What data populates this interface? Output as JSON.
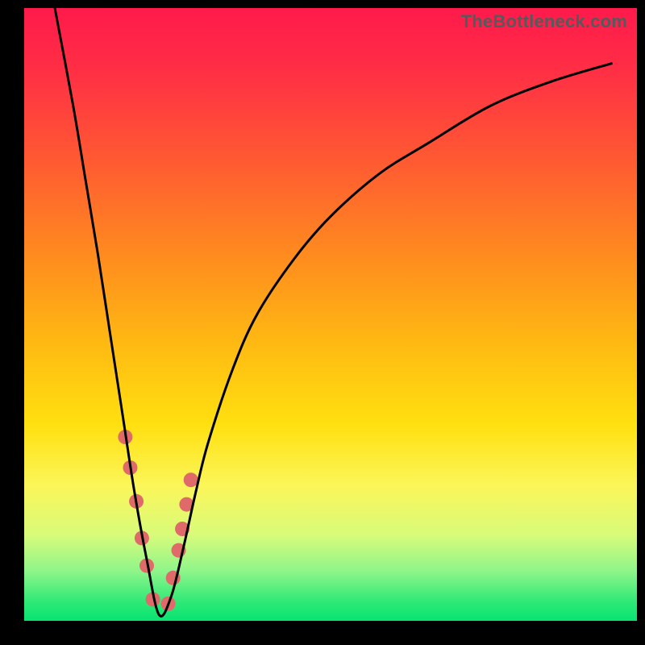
{
  "watermark": "TheBottleneck.com",
  "gradient": {
    "stops": [
      {
        "offset": 0.0,
        "color": "#ff1a4b"
      },
      {
        "offset": 0.1,
        "color": "#ff2e45"
      },
      {
        "offset": 0.25,
        "color": "#ff5a32"
      },
      {
        "offset": 0.4,
        "color": "#ff8a1f"
      },
      {
        "offset": 0.55,
        "color": "#ffba12"
      },
      {
        "offset": 0.68,
        "color": "#ffe010"
      },
      {
        "offset": 0.78,
        "color": "#fbf65a"
      },
      {
        "offset": 0.86,
        "color": "#d8fb7a"
      },
      {
        "offset": 0.92,
        "color": "#8df58a"
      },
      {
        "offset": 0.97,
        "color": "#2de976"
      },
      {
        "offset": 1.0,
        "color": "#08e372"
      }
    ]
  },
  "chart_data": {
    "type": "line",
    "title": "",
    "xlabel": "",
    "ylabel": "",
    "xlim": [
      0,
      100
    ],
    "ylim": [
      0,
      100
    ],
    "note": "V-shaped bottleneck curve; y ≈ mismatch percentage. Minimum ≈ 0 near x ≈ 22. Values estimated from pixel positions (no axis ticks shown).",
    "x": [
      5,
      8,
      10,
      12,
      14,
      16,
      18,
      20,
      22,
      24,
      26,
      28,
      30,
      34,
      38,
      44,
      50,
      58,
      66,
      76,
      86,
      96
    ],
    "y": [
      100,
      84,
      72,
      60,
      47,
      34,
      21,
      10,
      1,
      4,
      12,
      21,
      29,
      41,
      50,
      59,
      66,
      73,
      78,
      84,
      88,
      91
    ],
    "series": [
      {
        "name": "bottleneck-curve",
        "color": "#000000",
        "x": [
          5,
          8,
          10,
          12,
          14,
          16,
          18,
          20,
          22,
          24,
          26,
          28,
          30,
          34,
          38,
          44,
          50,
          58,
          66,
          76,
          86,
          96
        ],
        "y": [
          100,
          84,
          72,
          60,
          47,
          34,
          21,
          10,
          1,
          4,
          12,
          21,
          29,
          41,
          50,
          59,
          66,
          73,
          78,
          84,
          88,
          91
        ]
      }
    ],
    "markers": {
      "name": "highlight-dots",
      "color": "#e06a6a",
      "radius_px": 9,
      "x": [
        16.5,
        17.3,
        18.3,
        19.2,
        20.0,
        21.0,
        23.5,
        24.3,
        25.2,
        25.8,
        26.5,
        27.2
      ],
      "y": [
        30.0,
        25.0,
        19.5,
        13.5,
        9.0,
        3.5,
        2.8,
        7.0,
        11.5,
        15.0,
        19.0,
        23.0
      ]
    }
  }
}
